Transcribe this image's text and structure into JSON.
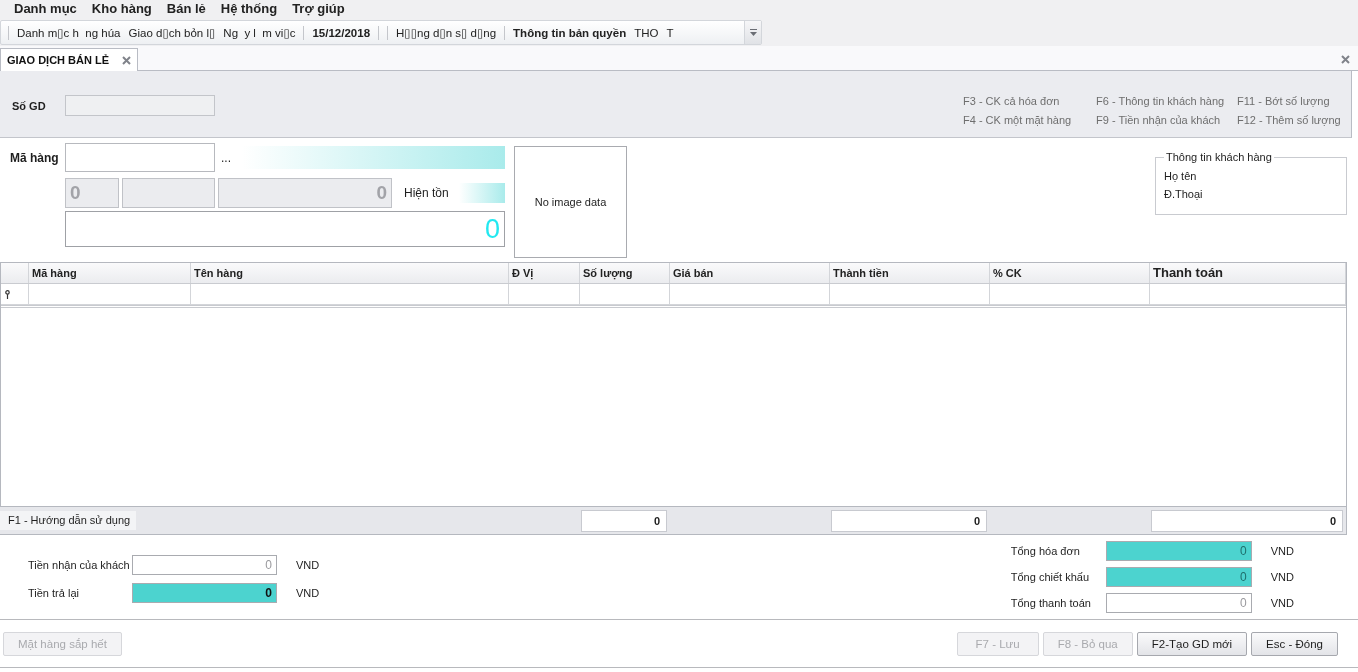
{
  "menu": [
    "Danh mục",
    "Kho hàng",
    "Bán lẻ",
    "Hệ thống",
    "Trợ giúp"
  ],
  "toolbar": {
    "items": [
      {
        "kind": "separator"
      },
      {
        "kind": "item",
        "label": "Danh m▯c h  ng húa",
        "bold": false
      },
      {
        "kind": "item",
        "label": "Giao d▯ch bỏn l▯",
        "bold": false
      },
      {
        "kind": "item",
        "label": "Ng  y l  m vi▯c",
        "bold": false
      },
      {
        "kind": "separator"
      },
      {
        "kind": "item",
        "label": "15/12/2018",
        "bold": true
      },
      {
        "kind": "separator"
      },
      {
        "kind": "separator"
      },
      {
        "kind": "item",
        "label": "H▯▯ng d▯n s▯ d▯ng",
        "bold": false
      },
      {
        "kind": "separator"
      },
      {
        "kind": "item",
        "label": "Thông tin bản quyền",
        "bold": true
      },
      {
        "kind": "item",
        "label": "THO",
        "bold": false
      },
      {
        "kind": "item",
        "label": "T",
        "bold": false
      }
    ]
  },
  "tabs": [
    {
      "label": "GIAO DỊCH BÁN LẺ",
      "selected": true
    }
  ],
  "header": {
    "transaction_label": "Số GD",
    "shortcuts": [
      "F3 - CK cả hóa đơn",
      "F4 - CK một mặt hàng",
      "F6 - Thông tin khách hàng",
      "F9 - Tiền nhận của khách",
      "F11 - Bớt số lượng",
      "F12 - Thêm số lượng"
    ]
  },
  "item_entry": {
    "code_label": "Mã hàng",
    "browse": "...",
    "detail_fields": [
      {
        "value": "0",
        "disabled": true
      },
      {
        "disabled": true
      },
      {
        "value": "0",
        "disabled": true
      }
    ],
    "stock_label": "Hiện tồn",
    "amount": "0",
    "image_text": "No image data"
  },
  "customer_info": {
    "title": "Thông tin khách hàng",
    "fields": [
      "Họ tên",
      "Đ.Thoại"
    ]
  },
  "grid": {
    "columns": [
      {
        "label": "Mã hàng",
        "emphasized": false
      },
      {
        "label": "Tên hàng",
        "emphasized": false
      },
      {
        "label": "Đ Vị",
        "emphasized": false
      },
      {
        "label": "Số lượng",
        "emphasized": false,
        "total": "0"
      },
      {
        "label": "Giá bán",
        "emphasized": false
      },
      {
        "label": "Thành tiền",
        "emphasized": false,
        "total": "0"
      },
      {
        "label": "% CK",
        "emphasized": false
      },
      {
        "label": "Thanh toán",
        "emphasized": true,
        "total": "0"
      }
    ],
    "footer_label": "F1 - Hướng dẫn sử dụng"
  },
  "summary": {
    "left": [
      {
        "label": "Tiền nhận của khách",
        "value": "0",
        "unit": "VND",
        "highlighted": false,
        "disabled": true
      },
      {
        "label": "Tiền trả lại",
        "value": "0",
        "unit": "VND",
        "highlighted": true,
        "disabled": false
      }
    ],
    "right": [
      {
        "label": "Tổng hóa đơn",
        "value": "0",
        "unit": "VND",
        "highlighted": true,
        "disabled": true
      },
      {
        "label": "Tổng chiết khấu",
        "value": "0",
        "unit": "VND",
        "highlighted": true,
        "disabled": true
      },
      {
        "label": "Tổng thanh toán",
        "value": "0",
        "unit": "VND",
        "highlighted": false,
        "disabled": true
      }
    ]
  },
  "buttons": {
    "left": [
      {
        "label": "Mặt hàng sắp hết",
        "disabled": true
      }
    ],
    "right": [
      {
        "label": "F7 - Lưu",
        "disabled": true
      },
      {
        "label": "F8 - Bỏ qua",
        "disabled": true
      },
      {
        "label": "F2-Tạo GD mới",
        "disabled": false
      },
      {
        "label": "Esc - Đóng",
        "disabled": false
      }
    ]
  }
}
